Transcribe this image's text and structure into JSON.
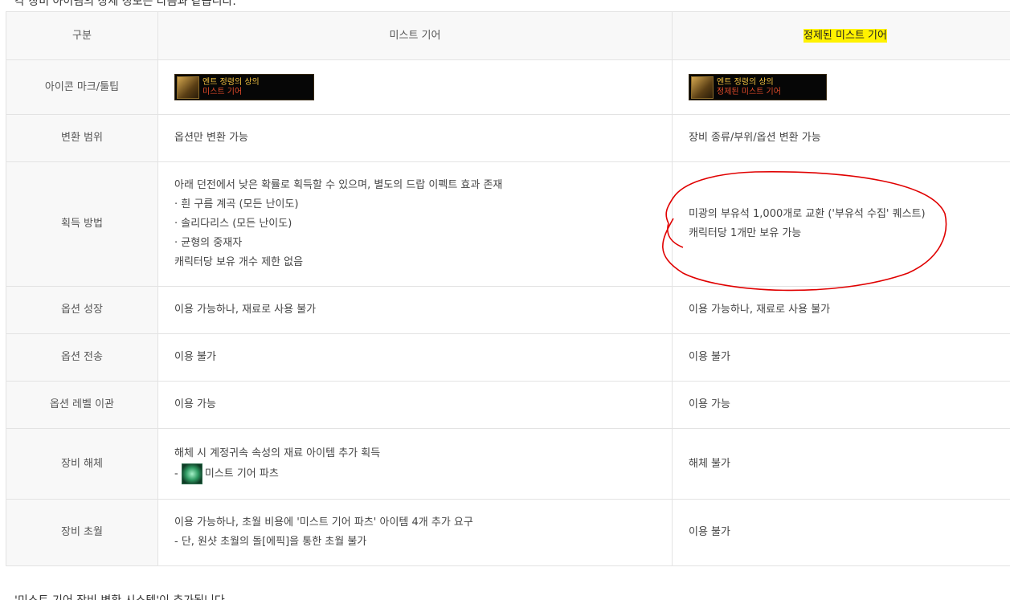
{
  "intro_text": "각 장비 아이템의 상세 정보는 다음과 같습니다.",
  "outro_text": "'미스트 기어 장비 변환 시스템'이 추가됩니다.",
  "header": {
    "col1": "구분",
    "col2": "미스트 기어",
    "col3": "정제된 미스트 기어"
  },
  "highlight_color": "#fff200",
  "annotation_color": "#e00000",
  "rows": {
    "icon": {
      "label": "아이콘 마크/툴팁",
      "mist_tip_name": "엔트 정령의 상의",
      "mist_tip_sub": "미스트 기어",
      "refined_tip_name": "엔트 정령의 상의",
      "refined_tip_sub": "정제된 미스트 기어"
    },
    "convert": {
      "label": "변환 범위",
      "mist": "옵션만 변환 가능",
      "refined": "장비 종류/부위/옵션 변환 가능"
    },
    "obtain": {
      "label": "획득 방법",
      "mist_lines": [
        "아래 던전에서 낮은 확률로 획득할 수 있으며, 별도의 드랍 이펙트 효과 존재",
        "·  흰 구름 계곡 (모든 난이도)",
        "·  솔리다리스 (모든 난이도)",
        "·  균형의 중재자",
        "캐릭터당 보유 개수 제한 없음"
      ],
      "refined_lines": [
        "미광의 부유석 1,000개로 교환 ('부유석 수집' 퀘스트)",
        "캐릭터당 1개만 보유 가능"
      ]
    },
    "growth": {
      "label": "옵션 성장",
      "mist": "이용 가능하나, 재료로 사용 불가",
      "refined": "이용 가능하나, 재료로 사용 불가"
    },
    "transfer": {
      "label": "옵션 전송",
      "mist": "이용 불가",
      "refined": "이용 불가"
    },
    "level": {
      "label": "옵션 레벨 이관",
      "mist": "이용 가능",
      "refined": "이용 가능"
    },
    "dismantle": {
      "label": "장비 해체",
      "mist_line1": "해체 시 계정귀속 속성의 재료 아이템 추가 획득",
      "mist_line2_prefix": "- ",
      "mist_line2_item": "미스트 기어 파츠",
      "refined": "해체 불가"
    },
    "transcend": {
      "label": "장비 초월",
      "mist_line1": "이용 가능하나, 초월 비용에 '미스트 기어 파츠' 아이템 4개 추가 요구",
      "mist_line2": "- 단, 원샷 초월의 돌[에픽]을 통한 초월 불가",
      "refined": "이용 불가"
    }
  }
}
